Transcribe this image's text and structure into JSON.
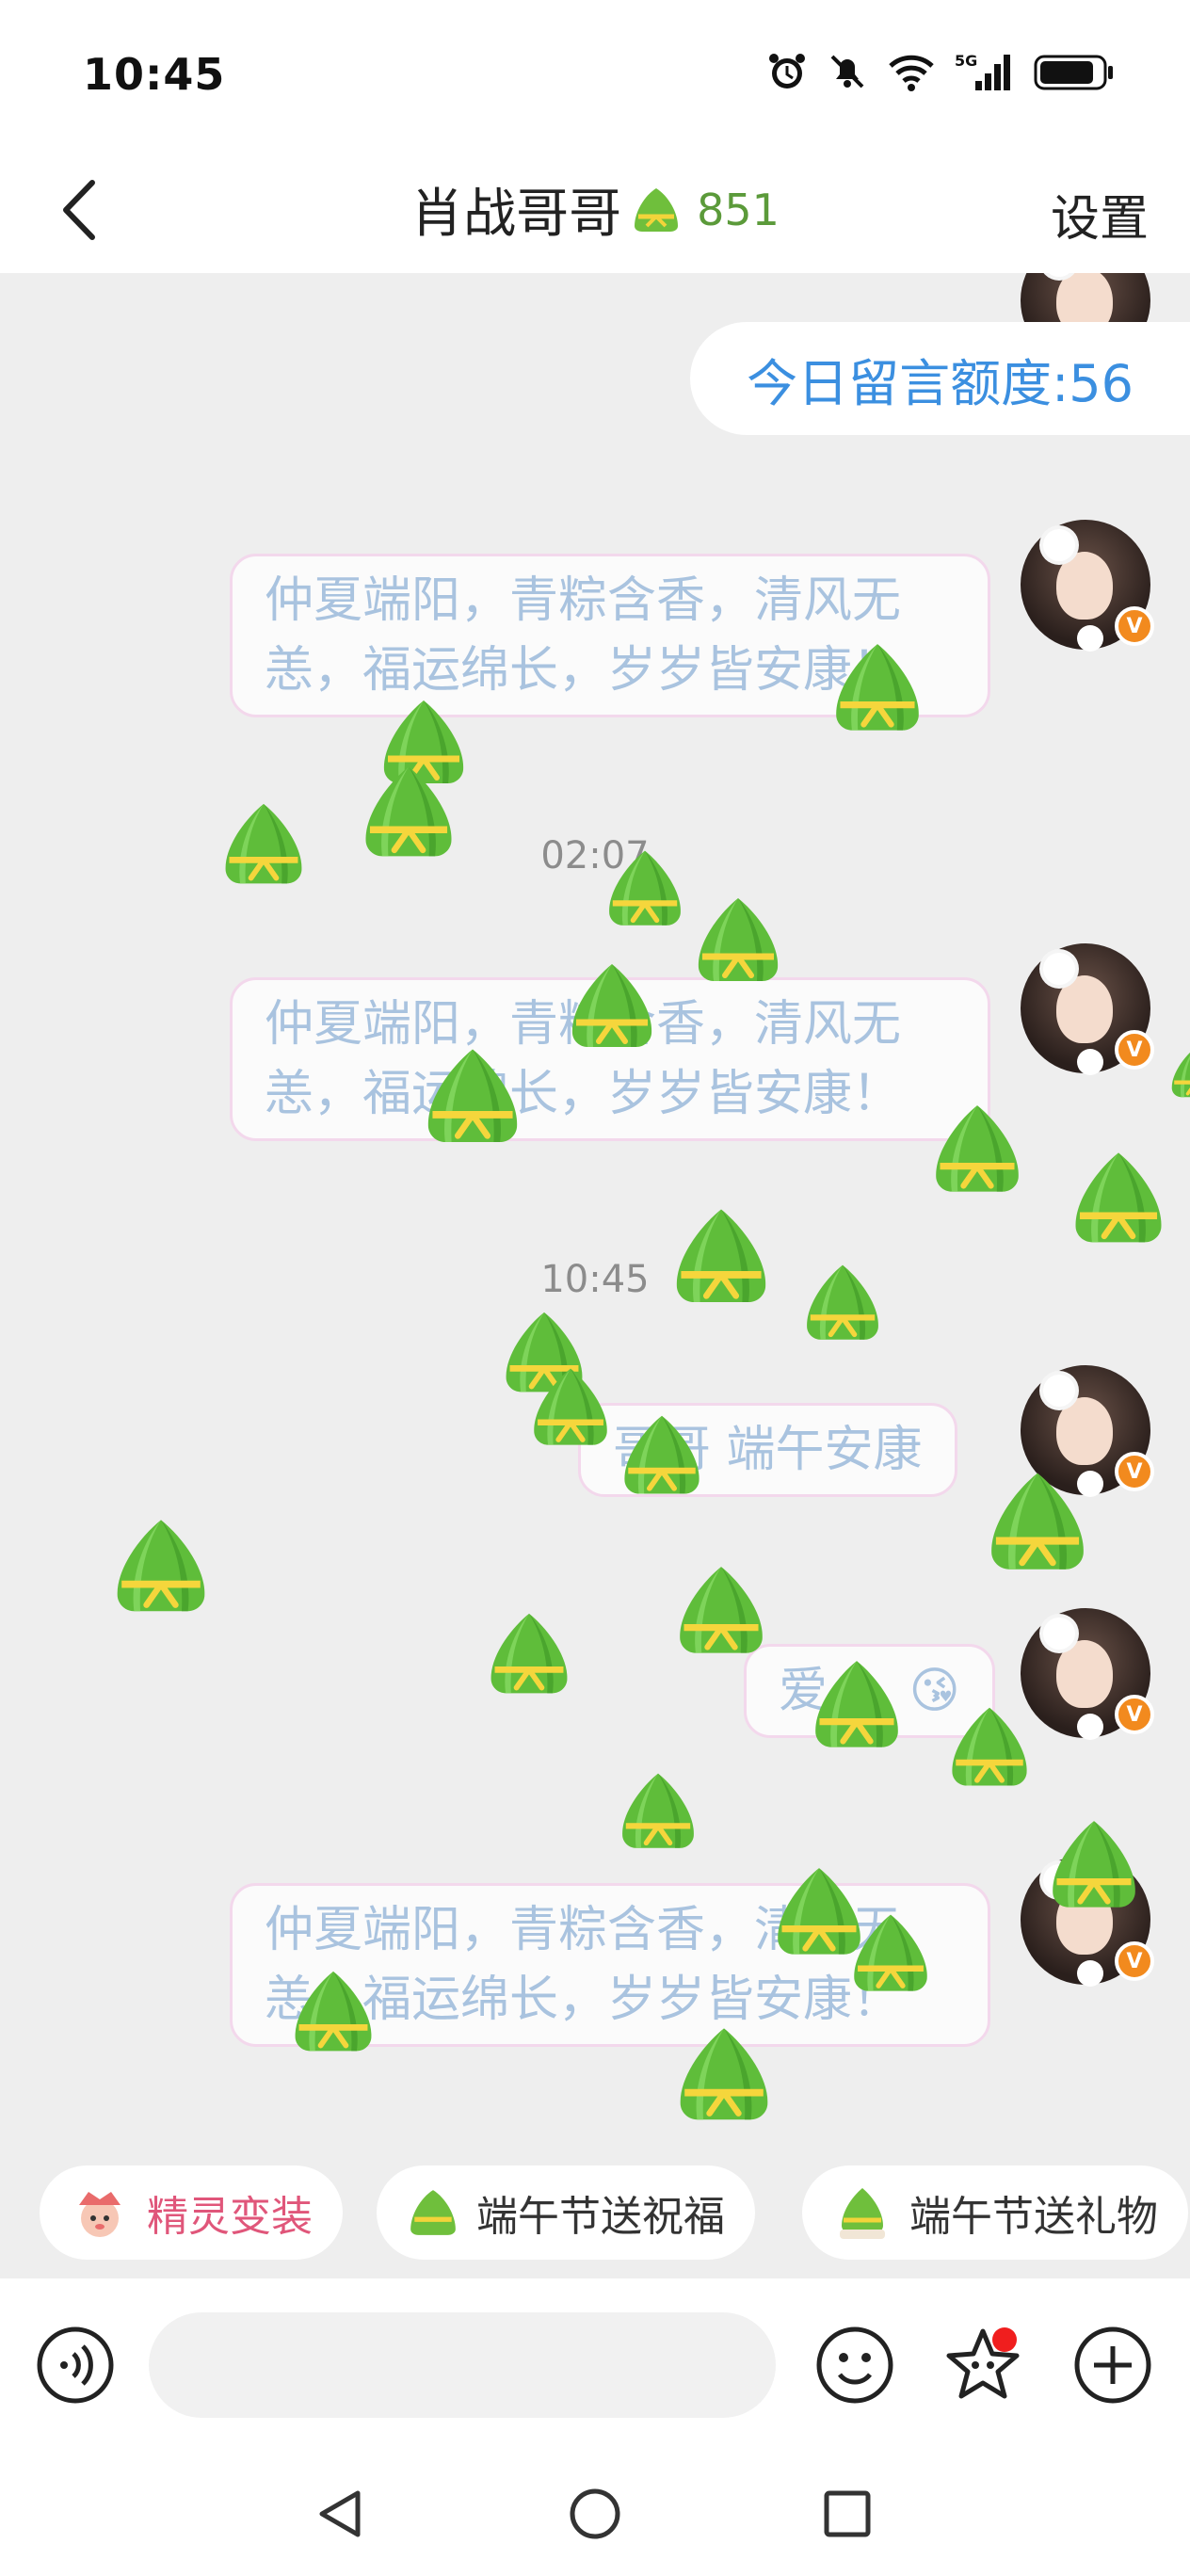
{
  "status_bar": {
    "time": "10:45",
    "icons": [
      "alarm-icon",
      "mute-icon",
      "wifi-icon",
      "signal-5g-icon",
      "battery-icon"
    ],
    "network_label": "5G"
  },
  "header": {
    "back_icon": "back-arrow-icon",
    "title": "肖战哥哥",
    "zongzi_count": "851",
    "settings_label": "设置"
  },
  "chat": {
    "quota_text": "今日留言额度:56",
    "messages": [
      {
        "text_line1": "仲夏端阳，青粽含香，清风无",
        "text_line2": "恙，福运绵长，岁岁皆安康！"
      },
      {
        "timestamp": "02:07"
      },
      {
        "text_line1": "仲夏端阳，青粽含香，清风无",
        "text_line2": "恙，福运绵长，岁岁皆安康！"
      },
      {
        "timestamp": "10:45"
      },
      {
        "text": "哥哥 端午安康"
      },
      {
        "text": "爱",
        "emoji": "😘"
      },
      {
        "text_line1": "仲夏端阳，青粽含香，清风无",
        "text_line2": "恙，福运绵长，岁岁皆安康！"
      }
    ],
    "avatar_badge": "V"
  },
  "quick_actions": [
    {
      "label": "精灵变装",
      "icon": "sprite-icon"
    },
    {
      "label": "端午节送祝福",
      "icon": "zongzi-icon"
    },
    {
      "label": "端午节送礼物",
      "icon": "gift-zongzi-icon"
    }
  ],
  "input_bar": {
    "voice_icon": "voice-icon",
    "placeholder": "",
    "emoji_icon": "emoji-icon",
    "sticker_icon": "star-sticker-icon",
    "plus_icon": "plus-icon"
  },
  "nav_bar": {
    "icons": [
      "nav-back-icon",
      "nav-home-icon",
      "nav-recents-icon"
    ]
  },
  "colors": {
    "accent_blue": "#3b8fe0",
    "bubble_text": "#a9c3df",
    "zongzi_green": "#5b9a3a",
    "badge_orange": "#f28a1e",
    "notify_red": "#f01e1e"
  }
}
